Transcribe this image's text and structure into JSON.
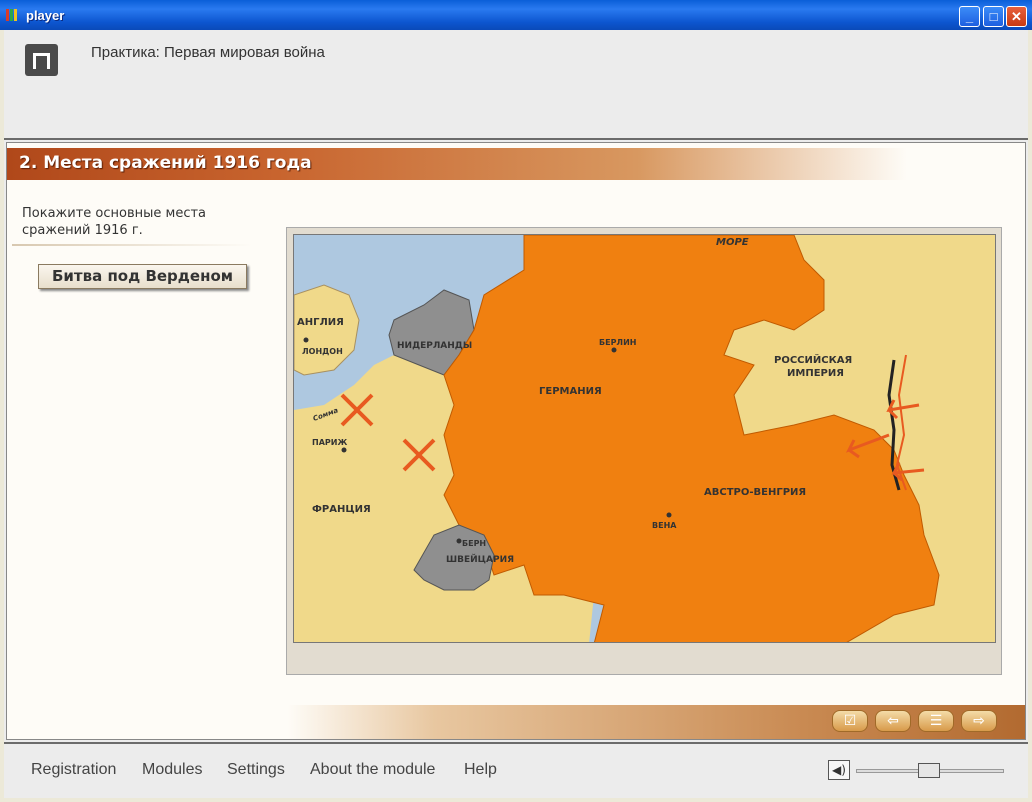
{
  "window": {
    "title": "player"
  },
  "header": {
    "course_title": "Практика: Первая мировая война"
  },
  "section": {
    "title": "2. Места сражений 1916 года"
  },
  "instruction": "Покажите основные места сражений 1916 г.",
  "battle_button": "Битва под Верденом",
  "map": {
    "labels": {
      "sea": "МОРЕ",
      "england": "АНГЛИЯ",
      "london": "ЛОНДОН",
      "netherlands": "НИДЕРЛАНДЫ",
      "paris": "ПАРИЖ",
      "france": "ФРАНЦИЯ",
      "berlin": "БЕРЛИН",
      "germany": "ГЕРМАНИЯ",
      "russia_1": "РОССИЙСКАЯ",
      "russia_2": "ИМПЕРИЯ",
      "austria": "АВСТРО-ВЕНГРИЯ",
      "vienna": "ВЕНА",
      "bern": "БЕРН",
      "switzerland": "ШВЕЙЦАРИЯ",
      "somme": "Сомма"
    },
    "colors": {
      "land": "#f0d98a",
      "water": "#aec8e0",
      "central_powers": "#f08010",
      "neutral": "#8f8f8f",
      "battle": "#e85a20"
    }
  },
  "nav_buttons": {
    "check": "☑",
    "back": "⇦",
    "menu": "☰",
    "next": "⇨"
  },
  "footer": {
    "items": [
      "Registration",
      "Modules",
      "Settings",
      "About the module",
      "Help"
    ],
    "speaker_icon": "speaker-icon",
    "volume": 0.5
  }
}
